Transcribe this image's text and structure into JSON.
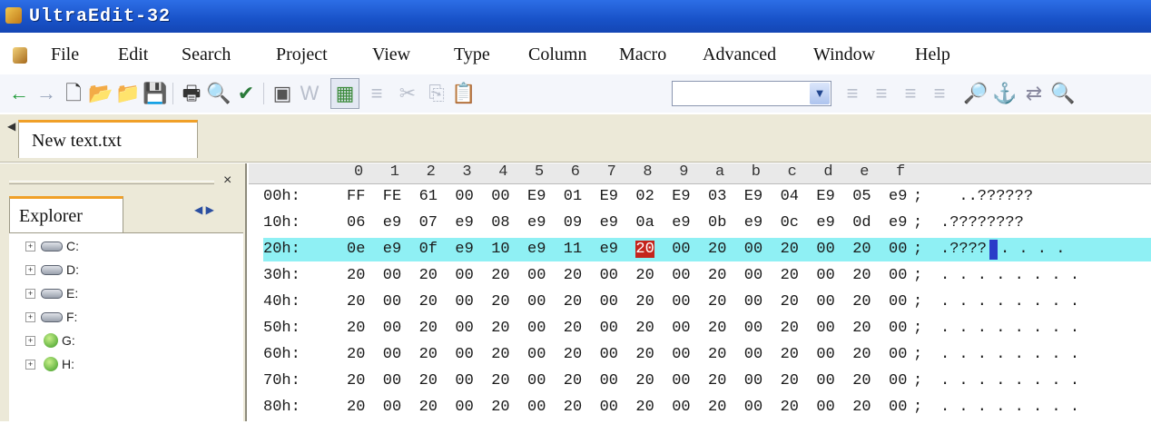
{
  "window": {
    "title": "UltraEdit-32"
  },
  "menu": [
    "File",
    "Edit",
    "Search",
    "Project",
    "View",
    "Type",
    "Column",
    "Macro",
    "Advanced",
    "Window",
    "Help"
  ],
  "toolbar": {
    "combo_value": "",
    "icons": [
      "back-arrow-icon",
      "forward-arrow-icon",
      "new-file-icon",
      "open-folder-icon",
      "open-icon",
      "save-icon",
      "print-icon",
      "print-preview-icon",
      "spell-icon",
      "properties-icon",
      "word-wrap-icon",
      "hex-mode-icon",
      "format-icon",
      "cut-icon",
      "copy-icon",
      "paste-icon",
      "align-left-icon",
      "align-center-icon",
      "align-right-icon",
      "justify-icon",
      "find-icon",
      "find-next-icon",
      "replace-icon",
      "find-in-files-icon"
    ]
  },
  "tabs": [
    {
      "label": "New text.txt"
    }
  ],
  "explorer": {
    "close_glyph": "×",
    "tab_label": "Explorer",
    "arrows": "◀ ▶",
    "drives": [
      "C:",
      "D:",
      "E:",
      "F:",
      "G:",
      "H:"
    ]
  },
  "hex": {
    "ruler": [
      "0",
      "1",
      "2",
      "3",
      "4",
      "5",
      "6",
      "7",
      "8",
      "9",
      "a",
      "b",
      "c",
      "d",
      "e",
      "f"
    ],
    "rows": [
      {
        "offset": "00h:",
        "bytes": [
          "FF",
          "FE",
          "61",
          "00",
          "00",
          "E9",
          "01",
          "E9",
          "02",
          "E9",
          "03",
          "E9",
          "04",
          "E9",
          "05",
          "e9"
        ],
        "sep": ";",
        "ascii": "  ..??????"
      },
      {
        "offset": "10h:",
        "bytes": [
          "06",
          "e9",
          "07",
          "e9",
          "08",
          "e9",
          "09",
          "e9",
          "0a",
          "e9",
          "0b",
          "e9",
          "0c",
          "e9",
          "0d",
          "e9"
        ],
        "sep": ";",
        "ascii": ".????????"
      },
      {
        "offset": "20h:",
        "bytes": [
          "0e",
          "e9",
          "0f",
          "e9",
          "10",
          "e9",
          "11",
          "e9",
          "20",
          "00",
          "20",
          "00",
          "20",
          "00",
          "20",
          "00"
        ],
        "sep": ";",
        "ascii": ".????",
        "ascii_tail": ". . . ."
      },
      {
        "offset": "30h:",
        "bytes": [
          "20",
          "00",
          "20",
          "00",
          "20",
          "00",
          "20",
          "00",
          "20",
          "00",
          "20",
          "00",
          "20",
          "00",
          "20",
          "00"
        ],
        "sep": ";",
        "ascii": ". . . . . . . ."
      },
      {
        "offset": "40h:",
        "bytes": [
          "20",
          "00",
          "20",
          "00",
          "20",
          "00",
          "20",
          "00",
          "20",
          "00",
          "20",
          "00",
          "20",
          "00",
          "20",
          "00"
        ],
        "sep": ";",
        "ascii": ". . . . . . . ."
      },
      {
        "offset": "50h:",
        "bytes": [
          "20",
          "00",
          "20",
          "00",
          "20",
          "00",
          "20",
          "00",
          "20",
          "00",
          "20",
          "00",
          "20",
          "00",
          "20",
          "00"
        ],
        "sep": ";",
        "ascii": ". . . . . . . ."
      },
      {
        "offset": "60h:",
        "bytes": [
          "20",
          "00",
          "20",
          "00",
          "20",
          "00",
          "20",
          "00",
          "20",
          "00",
          "20",
          "00",
          "20",
          "00",
          "20",
          "00"
        ],
        "sep": ";",
        "ascii": ". . . . . . . ."
      },
      {
        "offset": "70h:",
        "bytes": [
          "20",
          "00",
          "20",
          "00",
          "20",
          "00",
          "20",
          "00",
          "20",
          "00",
          "20",
          "00",
          "20",
          "00",
          "20",
          "00"
        ],
        "sep": ";",
        "ascii": ". . . . . . . ."
      },
      {
        "offset": "80h:",
        "bytes": [
          "20",
          "00",
          "20",
          "00",
          "20",
          "00",
          "20",
          "00",
          "20",
          "00",
          "20",
          "00",
          "20",
          "00",
          "20",
          "00"
        ],
        "sep": ";",
        "ascii": ". . . . . . . ."
      }
    ],
    "selected_row": 2,
    "cursor_byte": 8
  },
  "colors": {
    "titlebar": "#1852c8",
    "selection": "#8ff0f4",
    "cursor": "#c4241c",
    "tab_accent": "#f0a028"
  }
}
